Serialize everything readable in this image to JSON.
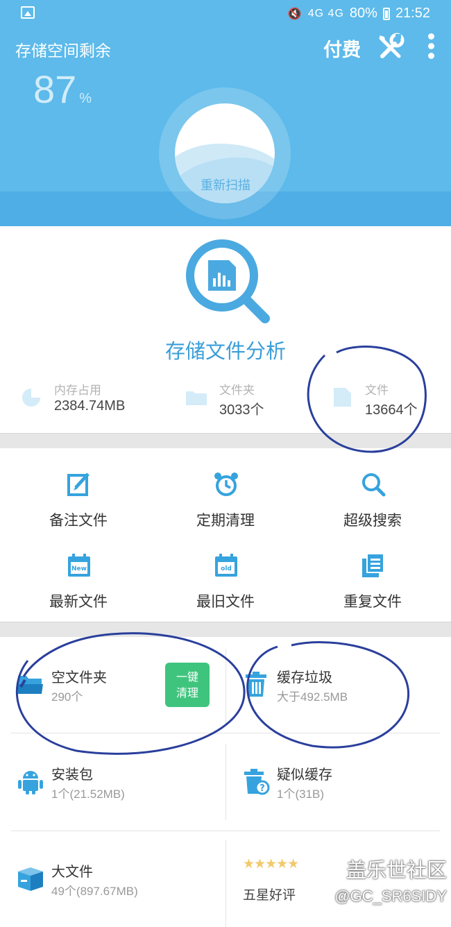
{
  "status_bar": {
    "battery": "80%",
    "time": "21:52",
    "signal": "4G 4G"
  },
  "header": {
    "title": "存储空间剩余",
    "pay_label": "付费",
    "percent": "87",
    "percent_unit": "%",
    "rescan_label": "重新扫描",
    "free_fraction": 0.87
  },
  "analysis": {
    "title": "存储文件分析",
    "stats": [
      {
        "label": "内存占用",
        "value": "2384.74MB",
        "icon": "pie-chart-icon"
      },
      {
        "label": "文件夹",
        "value": "3033个",
        "icon": "folder-icon"
      },
      {
        "label": "文件",
        "value": "13664个",
        "icon": "file-icon"
      }
    ]
  },
  "tools": [
    {
      "label": "备注文件",
      "icon": "edit-note-icon"
    },
    {
      "label": "定期清理",
      "icon": "alarm-clock-icon"
    },
    {
      "label": "超级搜索",
      "icon": "search-icon"
    },
    {
      "label": "最新文件",
      "icon": "calendar-new-icon",
      "badge": "New"
    },
    {
      "label": "最旧文件",
      "icon": "calendar-old-icon",
      "badge": "old"
    },
    {
      "label": "重复文件",
      "icon": "duplicate-files-icon"
    }
  ],
  "cards": {
    "empty_folder": {
      "title": "空文件夹",
      "sub": "290个",
      "button": "一键清理"
    },
    "cache_junk": {
      "title": "缓存垃圾",
      "sub": "大于492.5MB"
    },
    "apk": {
      "title": "安装包",
      "sub": "1个(21.52MB)"
    },
    "suspect_cache": {
      "title": "疑似缓存",
      "sub": "1个(31B)"
    },
    "big_files": {
      "title": "大文件",
      "sub": "49个(897.67MB)"
    },
    "rating": {
      "title": "五星好评",
      "stars": "★★★★★"
    }
  },
  "watermark": {
    "line1": "盖乐世社区",
    "line2": "@GC_SR6SIDY"
  },
  "colors": {
    "header_blue": "#5dbaea",
    "accent_blue": "#3a9ed8",
    "green": "#3fc47e",
    "pen_blue": "#2a3f9c"
  }
}
